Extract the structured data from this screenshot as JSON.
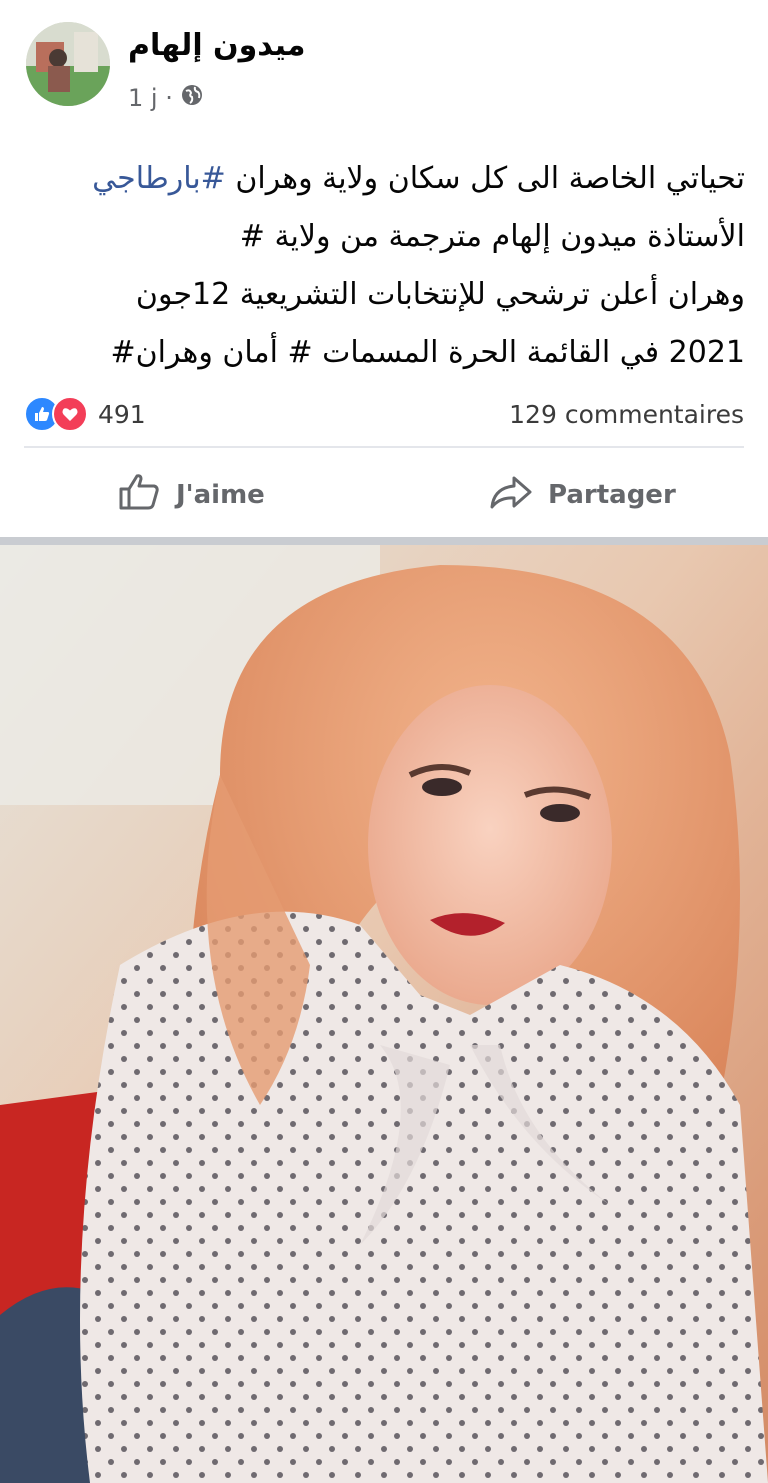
{
  "post": {
    "author_name": "ميدون إلهام",
    "time_label": "1 j ·",
    "privacy_icon": "globe-icon",
    "text_lines": [
      {
        "plain": "تحياتي الخاصة الى كل سكان ولاية وهران ",
        "hashtag": "#بارطاجي"
      },
      {
        "plain": "الأستاذة ميدون إلهام مترجمة من ولاية           #",
        "hashtag": ""
      },
      {
        "plain": "وهران أعلن ترشحي للإنتخابات التشريعية 12جون",
        "hashtag": ""
      },
      {
        "plain": "2021 في القائمة الحرة المسمات  # أمان وهران#",
        "hashtag": ""
      }
    ]
  },
  "engagement": {
    "reaction_count": "491",
    "comment_count": "129 commentaires",
    "reaction_icons": [
      "like-icon",
      "love-icon"
    ]
  },
  "actions": {
    "like_label": "J'aime",
    "share_label": "Partager"
  },
  "colors": {
    "hashtag": "#385898",
    "like_blue": "#2d88ff",
    "love_red": "#f33e58",
    "muted_text": "#65676b"
  }
}
